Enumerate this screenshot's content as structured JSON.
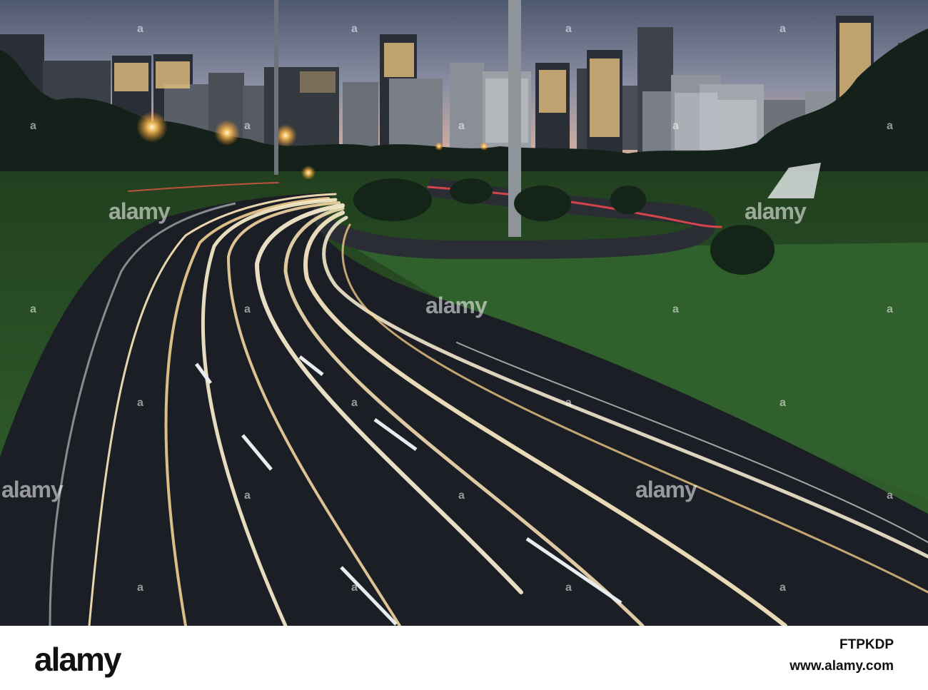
{
  "photo": {
    "scene": "city-skyline-highway-light-trails",
    "colors": {
      "sky_top": "#4e5870",
      "sky_horizon": "#d9b7a6",
      "grass": "#2f5a2a",
      "road": "#1c1f26",
      "trail": "#ffe7b8"
    }
  },
  "watermark": {
    "text": "alamy",
    "dot_text": "a"
  },
  "footer": {
    "logo": "alamy",
    "image_id": "FTPKDP",
    "url": "www.alamy.com"
  }
}
